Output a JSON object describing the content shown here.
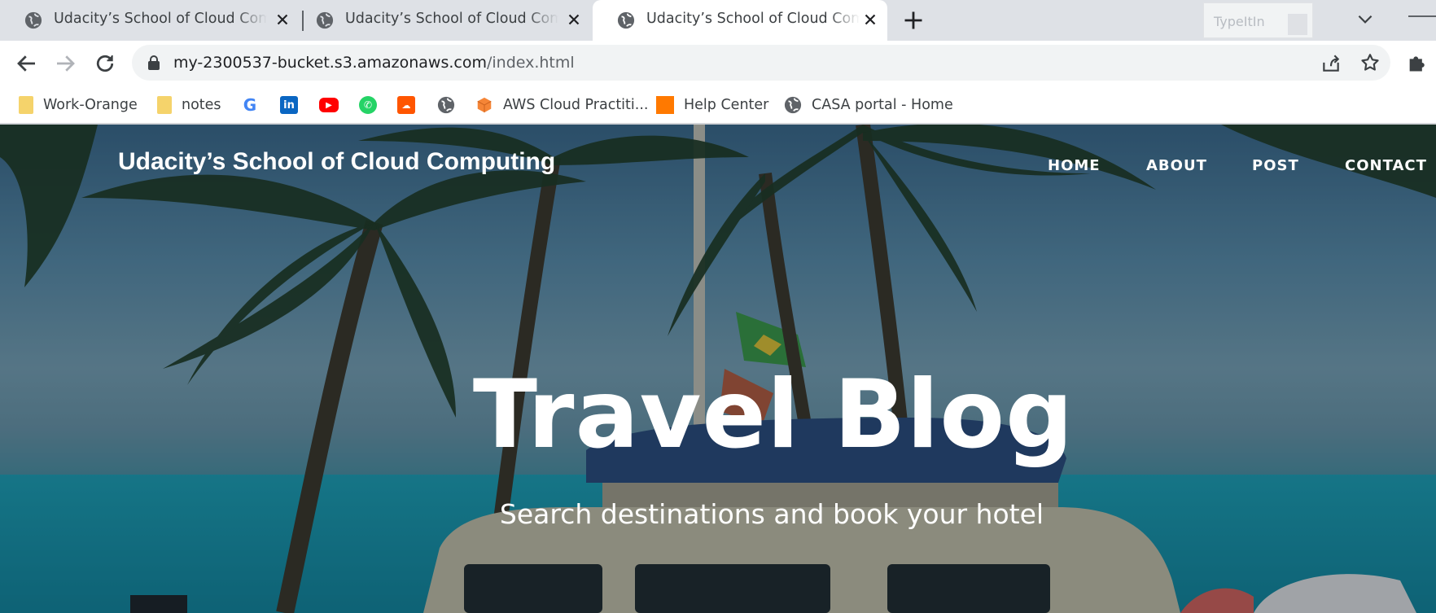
{
  "browser": {
    "tabs": [
      {
        "title": "Udacity’s School of Cloud Computing",
        "favicon": "globe-icon",
        "active": false
      },
      {
        "title": "Udacity’s School of Cloud Computing",
        "favicon": "globe-icon",
        "active": false
      },
      {
        "title": "Udacity’s School of Cloud Computing",
        "favicon": "globe-icon",
        "active": true
      }
    ],
    "typeit_label": "TypeItIn",
    "address": {
      "host": "my-2300537-bucket.s3.amazonaws.com",
      "path": "/index.html"
    },
    "bookmarks": [
      {
        "label": "Work-Orange",
        "icon": "folder-icon",
        "color": "#f5d36b"
      },
      {
        "label": "notes",
        "icon": "folder-icon",
        "color": "#f5d36b"
      },
      {
        "label": "",
        "icon": "google-icon",
        "color": "#4285f4"
      },
      {
        "label": "",
        "icon": "linkedin-icon",
        "color": "#0a66c2"
      },
      {
        "label": "",
        "icon": "youtube-icon",
        "color": "#ff0000"
      },
      {
        "label": "",
        "icon": "whatsapp-icon",
        "color": "#25d366"
      },
      {
        "label": "",
        "icon": "soundcloud-icon",
        "color": "#ff5500"
      },
      {
        "label": "",
        "icon": "globe-icon",
        "color": "#5f6368"
      },
      {
        "label": "AWS Cloud Practiti...",
        "icon": "aws-cube-icon",
        "color": "#f58536"
      },
      {
        "label": "Help Center",
        "icon": "orange-logo-icon",
        "color": "#ff7900"
      },
      {
        "label": "CASA portal - Home",
        "icon": "globe-icon",
        "color": "#5f6368"
      }
    ]
  },
  "site": {
    "brand": "Udacity’s School of Cloud Computing",
    "nav": [
      "HOME",
      "ABOUT",
      "POST",
      "CONTACT"
    ],
    "headline": "Travel Blog",
    "subheading": "Search destinations and book your hotel"
  }
}
